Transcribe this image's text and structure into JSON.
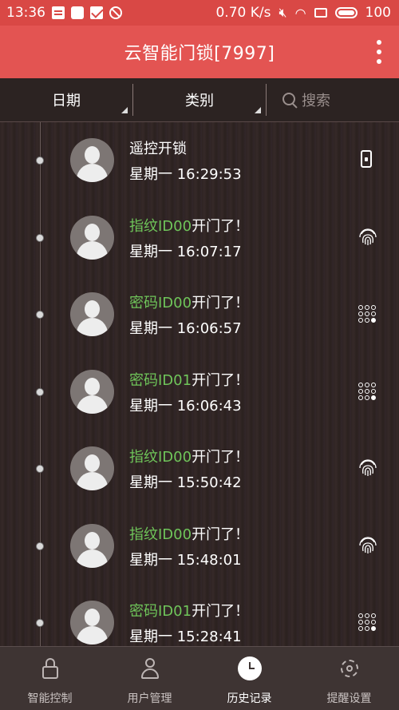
{
  "status_bar": {
    "time": "13:36",
    "speed": "0.70 K/s",
    "battery": "100"
  },
  "app": {
    "title": "云智能门锁[7997]"
  },
  "filters": {
    "date_label": "日期",
    "category_label": "类别",
    "search_placeholder": "搜索"
  },
  "records": [
    {
      "prefix": "",
      "text": "遥控开锁",
      "time": "星期一 16:29:53",
      "icon": "phone-remote-icon"
    },
    {
      "prefix": "指纹ID00",
      "text": "开门了！",
      "time": "星期一 16:07:17",
      "icon": "fingerprint-icon"
    },
    {
      "prefix": "密码ID00",
      "text": "开门了！",
      "time": "星期一 16:06:57",
      "icon": "keypad-icon"
    },
    {
      "prefix": "密码ID01",
      "text": "开门了！",
      "time": "星期一 16:06:43",
      "icon": "keypad-icon"
    },
    {
      "prefix": "指纹ID00",
      "text": "开门了！",
      "time": "星期一 15:50:42",
      "icon": "fingerprint-icon"
    },
    {
      "prefix": "指纹ID00",
      "text": "开门了！",
      "time": "星期一 15:48:01",
      "icon": "fingerprint-icon"
    },
    {
      "prefix": "密码ID01",
      "text": "开门了！",
      "time": "星期一 15:28:41",
      "icon": "keypad-icon"
    }
  ],
  "nav": [
    {
      "label": "智能控制",
      "icon": "lock-icon",
      "active": false
    },
    {
      "label": "用户管理",
      "icon": "user-icon",
      "active": false
    },
    {
      "label": "历史记录",
      "icon": "clock-icon",
      "active": true
    },
    {
      "label": "提醒设置",
      "icon": "gear-icon",
      "active": false
    }
  ],
  "colors": {
    "header": "#e35452",
    "status_bar": "#d94845",
    "highlight_green": "#6fc55a"
  }
}
